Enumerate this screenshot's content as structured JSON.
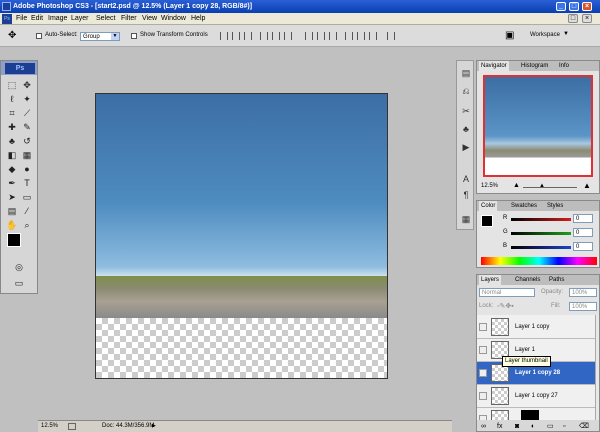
{
  "title": {
    "text": "Adobe Photoshop CS3 - [start2.psd @ 12.5% (Layer 1 copy 28, RGB/8#)]"
  },
  "menu": {
    "items": [
      "File",
      "Edit",
      "Image",
      "Layer",
      "Select",
      "Filter",
      "View",
      "Window",
      "Help"
    ]
  },
  "options": {
    "autoselect_label": "Auto-Select:",
    "autoselect_value": "Group",
    "transform_label": "Show Transform Controls",
    "workspace_label": "Workspace"
  },
  "toolbox": {
    "logo": "Ps"
  },
  "status": {
    "zoom": "12.5%",
    "doc": "Doc: 44.3M/356.9M"
  },
  "navigator": {
    "tabs": [
      "Navigator",
      "Histogram",
      "Info"
    ],
    "zoom": "12.5%"
  },
  "color": {
    "tabs": [
      "Color",
      "Swatches",
      "Styles"
    ],
    "channels": [
      {
        "label": "R",
        "value": "0",
        "color": "#d02020"
      },
      {
        "label": "G",
        "value": "0",
        "color": "#20a020"
      },
      {
        "label": "B",
        "value": "0",
        "color": "#2040d0"
      }
    ]
  },
  "layers": {
    "tabs": [
      "Layers",
      "Channels",
      "Paths"
    ],
    "blend": "Normal",
    "opacity_label": "Opacity:",
    "opacity": "100%",
    "lock_label": "Lock:",
    "fill_label": "Fill:",
    "fill": "100%",
    "rows": [
      {
        "name": "Layer 1 copy"
      },
      {
        "name": "Layer 1"
      },
      {
        "name": "Layer 1 copy 28"
      },
      {
        "name": "Layer 1 copy 27"
      },
      {
        "name": ""
      }
    ],
    "tooltip": "Layer thumbnail"
  }
}
